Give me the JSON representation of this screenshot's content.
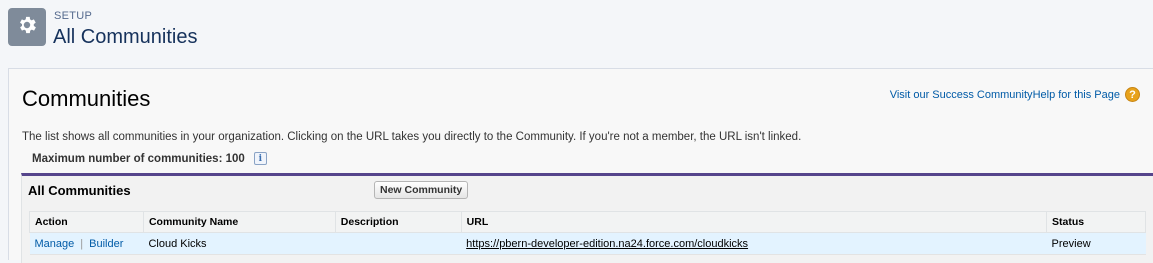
{
  "header": {
    "eyebrow": "SETUP",
    "title": "All Communities",
    "icon": "gear-icon"
  },
  "panel": {
    "title": "Communities",
    "help": {
      "success_link": "Visit our Success Community",
      "help_link": "Help for this Page",
      "icon": "question-icon"
    },
    "description": "The list shows all communities in your organization. Clicking on the URL takes you directly to the Community. If you're not a member, the URL isn't linked.",
    "max_label": "Maximum number of communities: 100",
    "info_icon": "info-icon"
  },
  "list": {
    "title": "All Communities",
    "new_button": "New Community",
    "columns": [
      "Action",
      "Community Name",
      "Description",
      "URL",
      "Status"
    ],
    "rows": [
      {
        "action_manage": "Manage",
        "action_sep": "|",
        "action_builder": "Builder",
        "name": "Cloud Kicks",
        "description": "",
        "url": "https://pbern-developer-edition.na24.force.com/cloudkicks",
        "status": "Preview"
      }
    ]
  },
  "colors": {
    "accent_bar": "#56458c",
    "link": "#015ba7",
    "row_highlight": "#e3f3ff"
  }
}
